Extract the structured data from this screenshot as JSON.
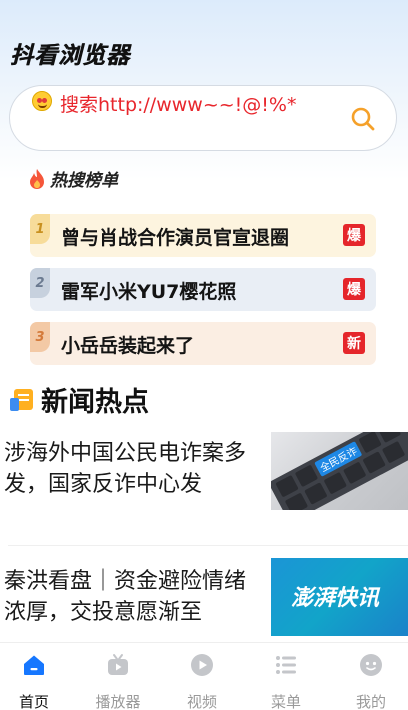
{
  "app": {
    "title": "抖看浏览器"
  },
  "search": {
    "text": "搜索http://www~~!@!%*"
  },
  "hot": {
    "title": "热搜榜单",
    "items": [
      {
        "rank": "1",
        "text": "曾与肖战合作演员官宣退圈",
        "tag": "爆"
      },
      {
        "rank": "2",
        "text": "雷军小米YU7樱花照",
        "tag": "爆"
      },
      {
        "rank": "3",
        "text": "小岳岳装起来了",
        "tag": "新"
      }
    ]
  },
  "news": {
    "title": "新闻热点",
    "items": [
      {
        "text": "涉海外中国公民电诈案多发，国家反诈中心发",
        "thumb_label": "全民反诈"
      },
      {
        "text": "秦洪看盘｜资金避险情绪浓厚，交投意愿渐至",
        "thumb_label": "澎湃快讯"
      }
    ]
  },
  "tabbar": {
    "items": [
      {
        "label": "首页",
        "icon": "home-icon",
        "active": true
      },
      {
        "label": "播放器",
        "icon": "tv-icon",
        "active": false
      },
      {
        "label": "视频",
        "icon": "play-icon",
        "active": false
      },
      {
        "label": "菜单",
        "icon": "menu-icon",
        "active": false
      },
      {
        "label": "我的",
        "icon": "profile-icon",
        "active": false
      }
    ]
  },
  "colors": {
    "accent": "#1677ff",
    "hot_tag": "#e5262b",
    "search_text": "#e8262c",
    "search_icon": "#f5a12a"
  }
}
